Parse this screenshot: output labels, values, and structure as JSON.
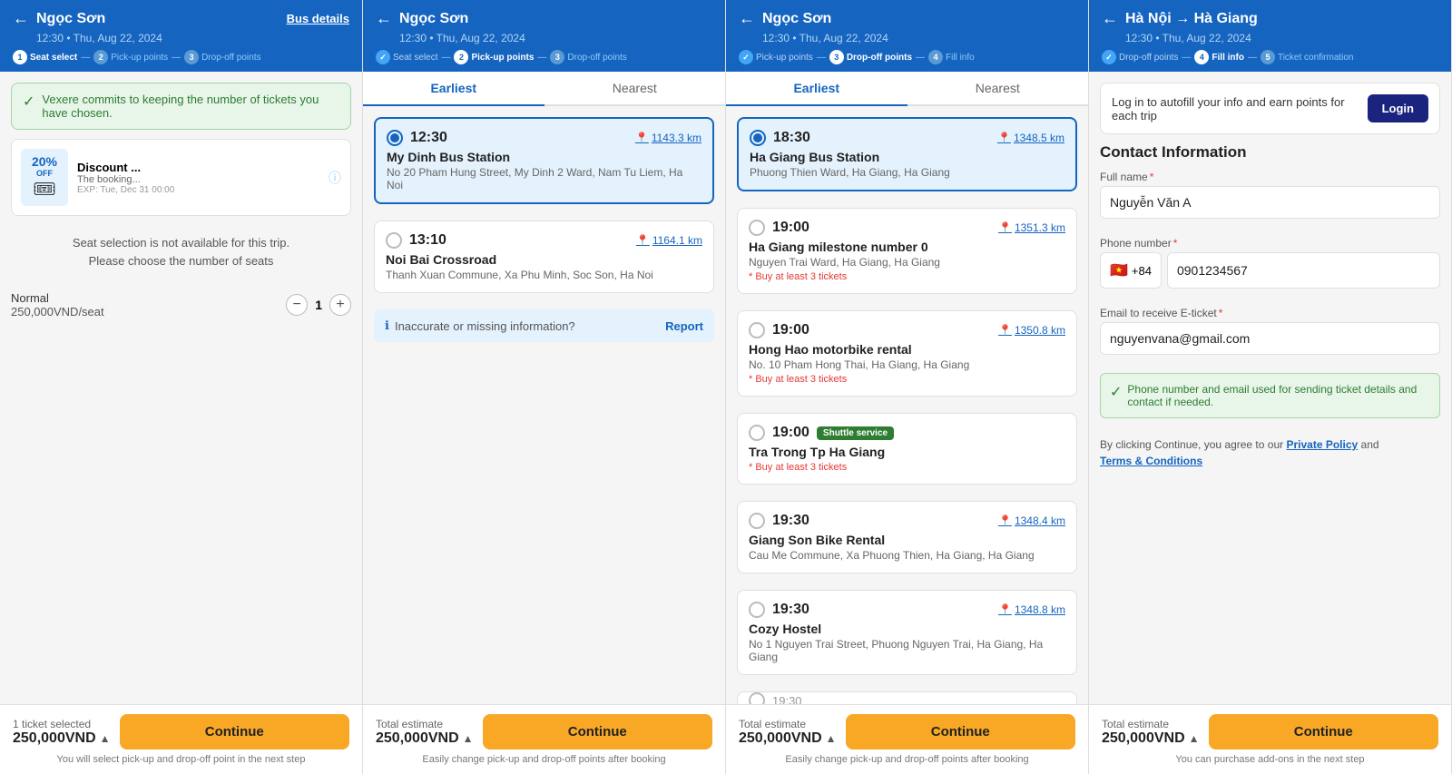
{
  "panels": [
    {
      "id": "panel1",
      "header": {
        "title": "Ngọc Sơn",
        "subtitle": "12:30 • Thu, Aug 22, 2024",
        "link": "Bus details",
        "back_icon": "←",
        "steps": [
          {
            "num": "1",
            "label": "Seat select",
            "state": "active"
          },
          {
            "sep": "—"
          },
          {
            "num": "2",
            "label": "Pick-up points",
            "state": "inactive"
          },
          {
            "sep": "—"
          },
          {
            "num": "3",
            "label": "Drop-off points",
            "state": "inactive"
          }
        ]
      },
      "notice": "Vexere commits to keeping the number of tickets you have chosen.",
      "discount": {
        "pct": "20%",
        "off": "OFF",
        "title": "Discount ...",
        "sub": "The booking...",
        "exp": "EXP: Tue, Dec 31 00:00"
      },
      "seat_unavailable": "Seat selection is not available for this trip.\nPlease choose the number of seats",
      "seat_type": "Normal",
      "seat_price": "250,000VND/seat",
      "seat_count": "1",
      "footer": {
        "selected_label": "1 ticket selected",
        "price": "250,000VND",
        "chevron": "▲",
        "continue_label": "Continue",
        "note": "You will select pick-up and drop-off point in the next step"
      }
    },
    {
      "id": "panel2",
      "header": {
        "title": "Ngọc Sơn",
        "subtitle": "12:30 • Thu, Aug 22, 2024",
        "back_icon": "←",
        "steps": [
          {
            "num": "✓",
            "label": "Seat select",
            "state": "done"
          },
          {
            "sep": "—"
          },
          {
            "num": "2",
            "label": "Pick-up points",
            "state": "active"
          },
          {
            "sep": "—"
          },
          {
            "num": "3",
            "label": "Drop-off points",
            "state": "inactive"
          }
        ]
      },
      "tabs": [
        "Earliest",
        "Nearest"
      ],
      "active_tab": "Earliest",
      "locations": [
        {
          "time": "12:30",
          "name": "My Dinh Bus Station",
          "address": "No 20 Pham Hung Street, My Dinh 2 Ward, Nam Tu Liem, Ha Noi",
          "dist": "1143.3 km",
          "selected": true,
          "min_tickets": null
        },
        {
          "time": "13:10",
          "name": "Noi Bai Crossroad",
          "address": "Thanh Xuan Commune, Xa Phu Minh, Soc Son, Ha Noi",
          "dist": "1164.1 km",
          "selected": false,
          "min_tickets": null
        }
      ],
      "report_bar": {
        "text": "Inaccurate or missing information?",
        "link": "Report"
      },
      "footer": {
        "selected_label": "Total estimate",
        "price": "250,000VND",
        "chevron": "▲",
        "continue_label": "Continue",
        "note": "Easily change pick-up and drop-off points after booking"
      }
    },
    {
      "id": "panel3",
      "header": {
        "title": "Ngọc Sơn",
        "subtitle": "12:30 • Thu, Aug 22, 2024",
        "back_icon": "←",
        "steps": [
          {
            "num": "✓",
            "label": "Pick-up points",
            "state": "done"
          },
          {
            "sep": "—"
          },
          {
            "num": "3",
            "label": "Drop-off points",
            "state": "active"
          },
          {
            "sep": "—"
          },
          {
            "num": "4",
            "label": "Fill info",
            "state": "inactive"
          }
        ]
      },
      "tabs": [
        "Earliest",
        "Nearest"
      ],
      "active_tab": "Earliest",
      "locations": [
        {
          "time": "18:30",
          "name": "Ha Giang Bus Station",
          "address": "Phuong Thien Ward, Ha Giang, Ha Giang",
          "dist": "1348.5 km",
          "selected": true,
          "min_tickets": null,
          "shuttle": false
        },
        {
          "time": "19:00",
          "name": "Ha Giang milestone number 0",
          "address": "Nguyen Trai Ward, Ha Giang, Ha Giang",
          "dist": "1351.3 km",
          "selected": false,
          "min_tickets": "* Buy at least 3 tickets",
          "shuttle": false
        },
        {
          "time": "19:00",
          "name": "Hong Hao motorbike rental",
          "address": "No. 10 Pham Hong Thai, Ha Giang, Ha Giang",
          "dist": "1350.8 km",
          "selected": false,
          "min_tickets": "* Buy at least 3 tickets",
          "shuttle": false
        },
        {
          "time": "19:00",
          "name": "Tra Trong Tp Ha Giang",
          "address": null,
          "dist": null,
          "selected": false,
          "min_tickets": "* Buy at least 3 tickets",
          "shuttle": true
        },
        {
          "time": "19:30",
          "name": "Giang Son Bike Rental",
          "address": "Cau Me Commune, Xa Phuong Thien, Ha Giang, Ha Giang",
          "dist": "1348.4 km",
          "selected": false,
          "min_tickets": null,
          "shuttle": false
        },
        {
          "time": "19:30",
          "name": "Cozy Hostel",
          "address": "No 1 Nguyen Trai Street, Phuong Nguyen Trai, Ha Giang, Ha Giang",
          "dist": "1348.8 km",
          "selected": false,
          "min_tickets": null,
          "shuttle": false
        }
      ],
      "footer": {
        "selected_label": "Total estimate",
        "price": "250,000VND",
        "chevron": "▲",
        "continue_label": "Continue",
        "note": "Easily change pick-up and drop-off points after booking"
      }
    },
    {
      "id": "panel4",
      "header": {
        "title": "Hà Nội → Hà Giang",
        "subtitle": "12:30 • Thu, Aug 22, 2024",
        "back_icon": "←",
        "steps": [
          {
            "num": "✓",
            "label": "Drop-off points",
            "state": "done"
          },
          {
            "sep": "—"
          },
          {
            "num": "4",
            "label": "Fill info",
            "state": "active"
          },
          {
            "sep": "—"
          },
          {
            "num": "5",
            "label": "Ticket confirmation",
            "state": "inactive"
          }
        ]
      },
      "login_text": "Log in to autofill your info and earn points for each trip",
      "login_btn": "Login",
      "contact_title": "Contact Information",
      "form": {
        "full_name_label": "Full name *",
        "full_name_value": "Nguyễn Văn A",
        "phone_country_code": "+84",
        "phone_flag": "🇻🇳",
        "phone_label": "Phone number *",
        "phone_value": "0901234567",
        "email_label": "Email to receive E-ticket *",
        "email_value": "nguyenvana@gmail.com"
      },
      "info_notice": "Phone number and email used for sending ticket details and contact if needed.",
      "policy_text": "By clicking Continue, you agree to our",
      "policy_link1": "Private Policy",
      "policy_and": "and",
      "policy_link2": "Terms & Conditions",
      "footer": {
        "selected_label": "Total estimate",
        "price": "250,000VND",
        "chevron": "▲",
        "continue_label": "Continue",
        "note": "You can purchase add-ons in the next step"
      }
    }
  ]
}
